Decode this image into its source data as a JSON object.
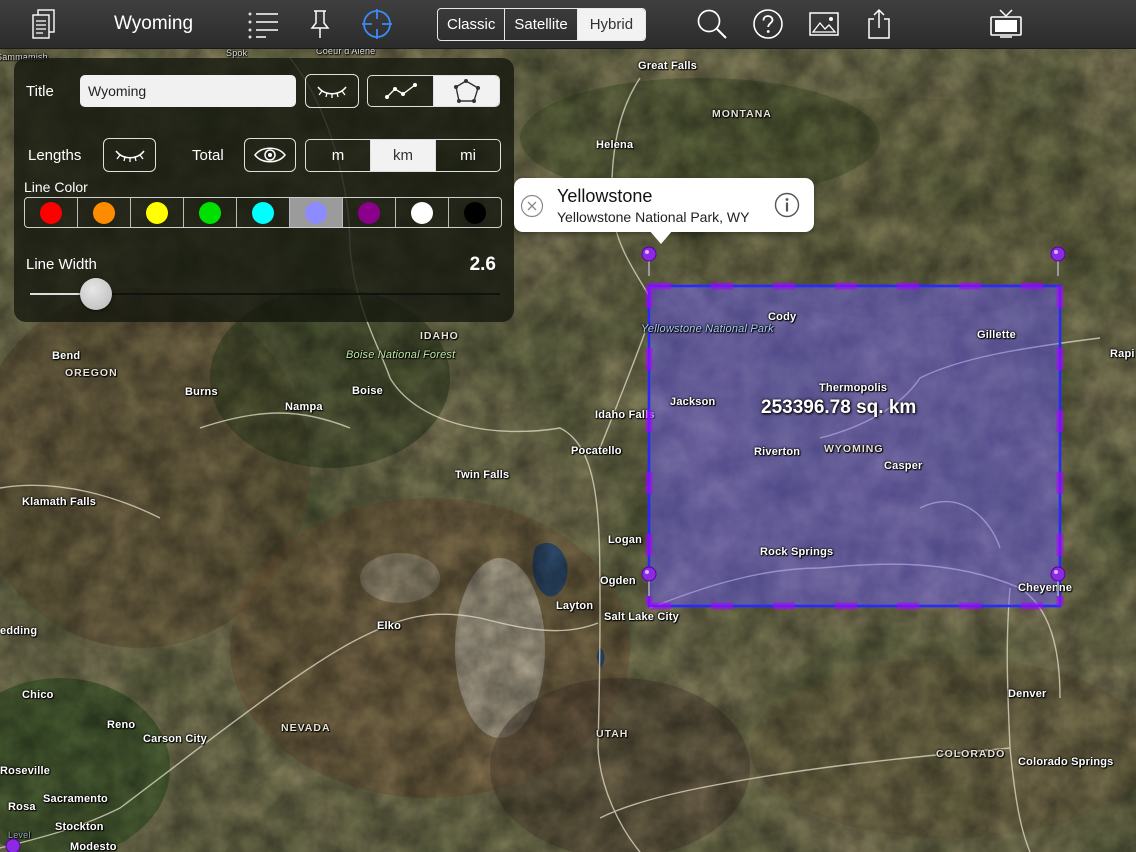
{
  "toolbar": {
    "title": "Wyoming",
    "map_types": [
      "Classic",
      "Satellite",
      "Hybrid"
    ],
    "selected_map_type": "Hybrid",
    "icons": [
      "document-icon",
      "list-icon",
      "pin-icon",
      "crosshair-icon",
      "search-icon",
      "help-icon",
      "image-icon",
      "share-icon",
      "tv-icon"
    ]
  },
  "panel": {
    "title_label": "Title",
    "title_value": "Wyoming",
    "lengths_label": "Lengths",
    "total_label": "Total",
    "units": [
      "m",
      "km",
      "mi"
    ],
    "selected_unit": "km",
    "line_color_label": "Line Color",
    "colors": [
      "#ff0000",
      "#ff8c00",
      "#ffff00",
      "#00e000",
      "#00ffff",
      "#8c8cff",
      "#8b008b",
      "#ffffff",
      "#000000"
    ],
    "selected_color": "#8c8cff",
    "line_width_label": "Line Width",
    "line_width_value": "2.6",
    "line_width_fraction": 0.14
  },
  "callout": {
    "title": "Yellowstone",
    "subtitle": "Yellowstone National Park, WY"
  },
  "polygon": {
    "area_label": "253396.78 sq. km",
    "fill_color": "#6a5cff",
    "stroke_color": "#2a2aff",
    "pin_color": "#8a2be2"
  },
  "places": {
    "great_falls": "Great Falls",
    "montana": "MONTANA",
    "helena": "Helena",
    "coeur": "Coeur d'Alene",
    "sammamish": "Sammamish",
    "spok": "Spok",
    "idaho": "IDAHO",
    "boise_nf": "Boise National Forest",
    "boise": "Boise",
    "nampa": "Nampa",
    "bend": "Bend",
    "oregon": "OREGON",
    "burns": "Burns",
    "idaho_falls": "Idaho Falls",
    "pocatello": "Pocatello",
    "twin_falls": "Twin Falls",
    "klamath": "Klamath Falls",
    "logan": "Logan",
    "ogden": "Ogden",
    "layton": "Layton",
    "slc": "Salt Lake City",
    "elko": "Elko",
    "redding": "edding",
    "chico": "Chico",
    "reno": "Reno",
    "carson": "Carson City",
    "nevada": "NEVADA",
    "utah": "UTAH",
    "roseville": "Roseville",
    "sacramento": "Sacramento",
    "rosa": "Rosa",
    "stockton": "Stockton",
    "modesto": "Modesto",
    "level": "Level",
    "yellowstone_np": "Yellowstone National Park",
    "cody": "Cody",
    "gillette": "Gillette",
    "rapid": "Rapi",
    "thermopolis": "Thermopolis",
    "jackson": "Jackson",
    "riverton": "Riverton",
    "wyoming": "WYOMING",
    "casper": "Casper",
    "rock_springs": "Rock Springs",
    "cheyenne": "Cheyenne",
    "denver": "Denver",
    "colorado": "COLORADO",
    "colorado_springs": "Colorado Springs"
  }
}
